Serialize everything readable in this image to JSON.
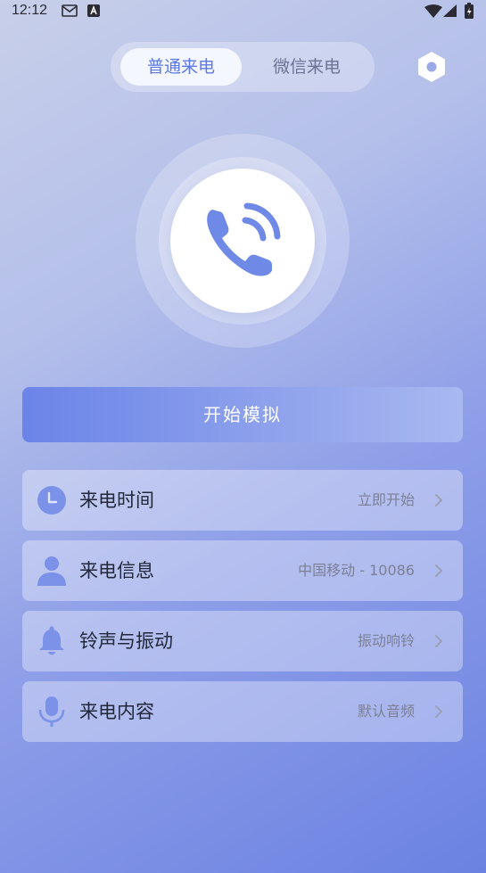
{
  "status_bar": {
    "time": "12:12"
  },
  "tabs": {
    "normal": "普通来电",
    "wechat": "微信来电",
    "active": "normal"
  },
  "start_button": "开始模拟",
  "settings": [
    {
      "label": "来电时间",
      "value": "立即开始",
      "icon": "clock-icon"
    },
    {
      "label": "来电信息",
      "value": "中国移动 - 10086",
      "icon": "person-icon"
    },
    {
      "label": "铃声与振动",
      "value": "振动响铃",
      "icon": "bell-icon"
    },
    {
      "label": "来电内容",
      "value": "默认音频",
      "icon": "microphone-icon"
    }
  ],
  "colors": {
    "accent": "#5b78e6",
    "icon": "#6f8ae6"
  }
}
